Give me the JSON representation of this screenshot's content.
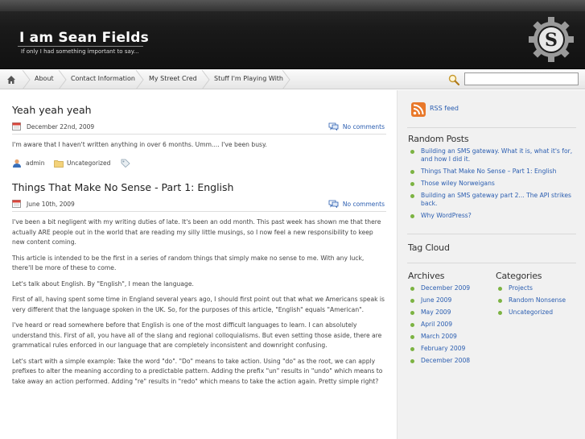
{
  "header": {
    "title": "I am Sean Fields",
    "description": "If only I had something important to say..."
  },
  "nav": {
    "items": [
      "About",
      "Contact Information",
      "My Street Cred",
      "Stuff I'm Playing With"
    ],
    "search_value": ""
  },
  "posts": [
    {
      "title": "Yeah yeah yeah",
      "date": "December 22nd, 2009",
      "comments": "No comments",
      "paragraphs": [
        "I'm aware that I haven't written anything in over 6 months. Umm.... I've been busy."
      ],
      "author": "admin",
      "category": "Uncategorized"
    },
    {
      "title": "Things That Make No Sense - Part 1: English",
      "date": "June 10th, 2009",
      "comments": "No comments",
      "paragraphs": [
        "I've been a bit negligent with my writing duties of late.  It's been an odd month.  This past week has shown me that there actually ARE people out in the world that are reading my silly little musings, so I now feel a new responsibility to keep new content coming.",
        "This article is intended to be the first in a series of random things that simply make no sense to me.  With any luck, there'll be more of these to come.",
        "Let's talk about English.  By \"English\", I mean the language.",
        "First of all, having spent some time in England several years ago, I should first point out that what we Americans speak is very different that the language spoken in the UK.  So, for the purposes of this article, \"English\" equals \"American\".",
        "I've heard or read somewhere before that English is one of the most difficult languages to learn.  I can absolutely understand this.  First of all, you have all of the slang and regional colloquialisms.  But even setting those aside, there are grammatical rules enforced in our language that are completely inconsistent and downright confusing.",
        "Let's start with a simple example:  Take the word \"do\".  \"Do\" means to take action.  Using \"do\" as the root, we can apply prefixes to alter the meaning according to a predictable pattern.  Adding the prefix \"un\" results in \"undo\" which means to take away an action performed.  Adding \"re\" results in \"redo\" which means to take the action again.  Pretty simple right?"
      ]
    }
  ],
  "sidebar": {
    "rss_label": "RSS feed",
    "random_posts_title": "Random Posts",
    "random_posts": [
      "Building an SMS gateway. What it is, what it's for, and how I did it.",
      "Things That Make No Sense – Part 1: English",
      "Those wiley Norweigans",
      "Building an SMS gateway part 2... The API strikes back.",
      "Why WordPress?"
    ],
    "tag_cloud_title": "Tag Cloud",
    "archives_title": "Archives",
    "archives": [
      "December 2009",
      "June 2009",
      "May 2009",
      "April 2009",
      "March 2009",
      "February 2009",
      "December 2008"
    ],
    "categories_title": "Categories",
    "categories": [
      "Projects",
      "Random Nonsense",
      "Uncategorized"
    ]
  },
  "colors": {
    "link": "#2a5db0",
    "header_bg": "#1a1a1a",
    "sidebar_bg": "#f1f1f1",
    "bullet": "#7cb342"
  }
}
